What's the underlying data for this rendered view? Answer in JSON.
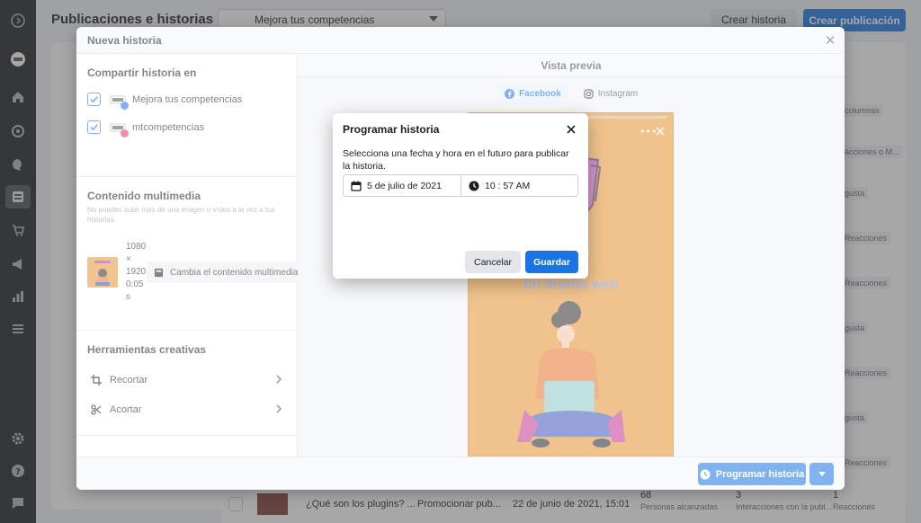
{
  "page": {
    "title": "Publicaciones e historias",
    "page_selector": "Mejora tus competencias",
    "create_story": "Crear historia",
    "create_post": "Crear publicación",
    "bg_columns": "columnas",
    "bg_interactions": "acciones o M...",
    "bg_cells": [
      "gusta",
      "Reacciones",
      "Reacciones",
      "gusta",
      "Reacciones",
      "gusta",
      "Reacciones"
    ],
    "bg_row": {
      "title": "¿Qué son los plugins? ...",
      "action": "Promocionar pub...",
      "date": "22 de junio de 2021, 15:01",
      "reach": "68",
      "reach_label": "Personas alcanzadas",
      "interactions": "3",
      "interactions_label": "Interacciones con la publ...",
      "reactions": "1",
      "reactions_label": "Reacciones"
    }
  },
  "modal": {
    "title": "Nueva historia",
    "share_title": "Compartir historia en",
    "accounts": [
      {
        "name": "Mejora tus competencias",
        "network": "facebook",
        "checked": true
      },
      {
        "name": "mtcompetencias",
        "network": "instagram",
        "checked": true
      }
    ],
    "media_title": "Contenido multimedia",
    "media_hint": "No puedes subir más de una imagen o vídeo a la vez a tus historias.",
    "media_dims": [
      "1080",
      "×",
      "1920",
      "0:05",
      "s"
    ],
    "change_media": "Cambia el contenido multimedia",
    "tools_title": "Herramientas creativas",
    "tools": [
      {
        "label": "Recortar",
        "icon": "crop-icon"
      },
      {
        "label": "Acortar",
        "icon": "scissors-icon"
      }
    ],
    "preview_title": "Vista previa",
    "preview_tabs": [
      {
        "label": "Facebook",
        "active": true
      },
      {
        "label": "Instagram",
        "active": false
      }
    ],
    "story_text_1": "cias",
    "story_text_2": "En diseño web",
    "schedule_button": "Programar historia"
  },
  "dialog": {
    "title": "Programar historia",
    "description": "Selecciona una fecha y hora en el futuro para publicar la historia.",
    "date": "5 de julio de 2021",
    "time": "10 : 57 AM",
    "cancel": "Cancelar",
    "save": "Guardar"
  },
  "colors": {
    "primary": "#1b74e4",
    "rail": "#1c1e21",
    "story_bg": "#e6922f"
  }
}
